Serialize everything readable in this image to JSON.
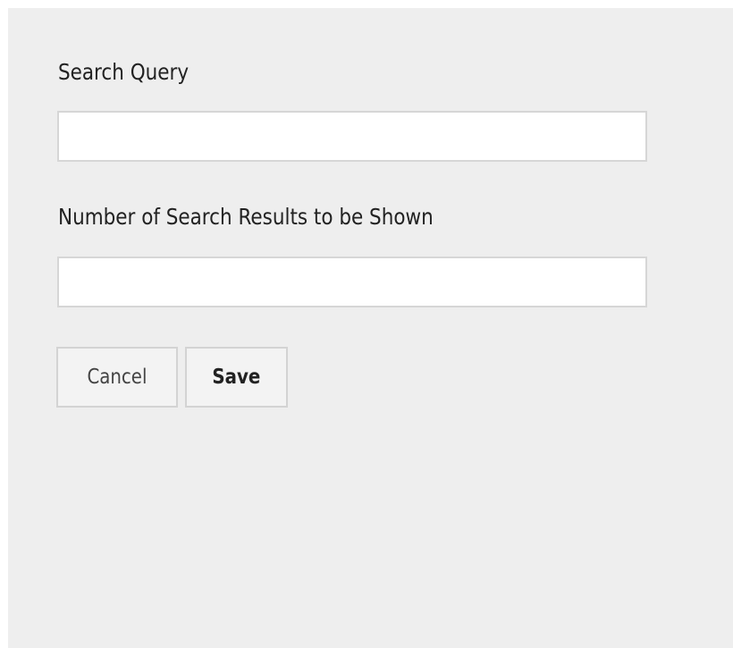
{
  "form": {
    "search_query_label": "Search Query",
    "search_query_value": "",
    "results_count_label": "Number of Search Results to be Shown",
    "results_count_value": ""
  },
  "actions": {
    "cancel_label": "Cancel",
    "save_label": "Save"
  },
  "colors": {
    "panel_background": "#eeeeee",
    "input_background": "#ffffff",
    "border": "#d6d6d6",
    "text": "#222222"
  }
}
